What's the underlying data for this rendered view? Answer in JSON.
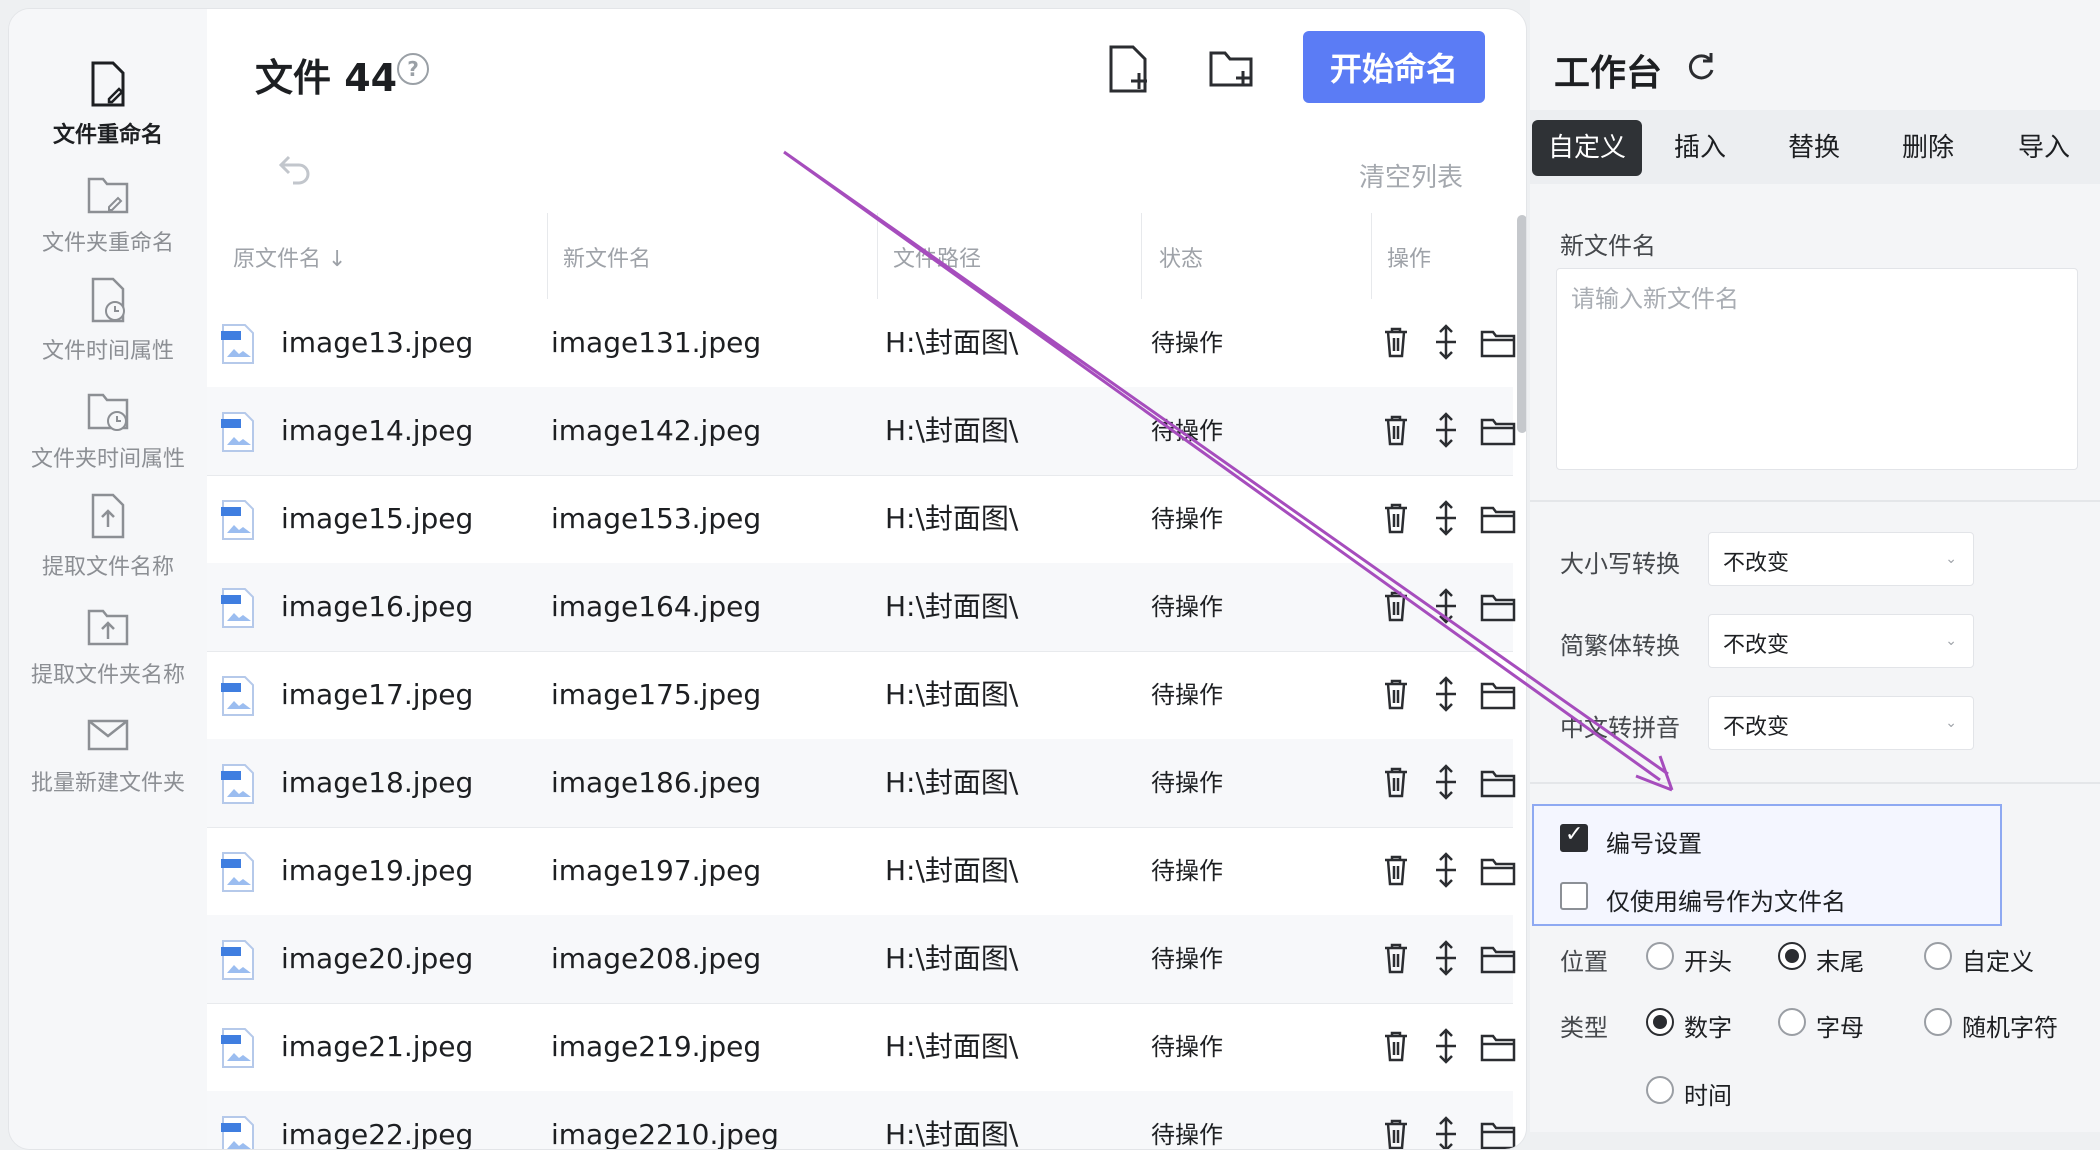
{
  "sidebar": {
    "items": [
      {
        "label": "文件重命名",
        "icon": "file-edit-icon",
        "active": true
      },
      {
        "label": "文件夹重命名",
        "icon": "folder-edit-icon"
      },
      {
        "label": "文件时间属性",
        "icon": "file-clock-icon"
      },
      {
        "label": "文件夹时间属性",
        "icon": "folder-clock-icon"
      },
      {
        "label": "提取文件名称",
        "icon": "file-upload-icon"
      },
      {
        "label": "提取文件夹名称",
        "icon": "folder-upload-icon"
      },
      {
        "label": "批量新建文件夹",
        "icon": "mail-icon"
      }
    ]
  },
  "main": {
    "title": "文件 44",
    "help_icon": "?",
    "start_button": "开始命名",
    "clear_list": "清空列表",
    "columns": [
      "原文件名",
      "新文件名",
      "文件路径",
      "状态",
      "操作"
    ],
    "sort_icon": "↓",
    "rows": [
      {
        "orig": "image13.jpeg",
        "new": "image131.jpeg",
        "path": "H:\\封面图\\",
        "status": "待操作"
      },
      {
        "orig": "image14.jpeg",
        "new": "image142.jpeg",
        "path": "H:\\封面图\\",
        "status": "待操作"
      },
      {
        "orig": "image15.jpeg",
        "new": "image153.jpeg",
        "path": "H:\\封面图\\",
        "status": "待操作"
      },
      {
        "orig": "image16.jpeg",
        "new": "image164.jpeg",
        "path": "H:\\封面图\\",
        "status": "待操作"
      },
      {
        "orig": "image17.jpeg",
        "new": "image175.jpeg",
        "path": "H:\\封面图\\",
        "status": "待操作"
      },
      {
        "orig": "image18.jpeg",
        "new": "image186.jpeg",
        "path": "H:\\封面图\\",
        "status": "待操作"
      },
      {
        "orig": "image19.jpeg",
        "new": "image197.jpeg",
        "path": "H:\\封面图\\",
        "status": "待操作"
      },
      {
        "orig": "image20.jpeg",
        "new": "image208.jpeg",
        "path": "H:\\封面图\\",
        "status": "待操作"
      },
      {
        "orig": "image21.jpeg",
        "new": "image219.jpeg",
        "path": "H:\\封面图\\",
        "status": "待操作"
      },
      {
        "orig": "image22.jpeg",
        "new": "image2210.jpeg",
        "path": "H:\\封面图\\",
        "status": "待操作"
      }
    ]
  },
  "panel": {
    "title": "工作台",
    "tabs": [
      "自定义",
      "插入",
      "替换",
      "删除",
      "导入"
    ],
    "new_name_label": "新文件名",
    "new_name_placeholder": "请输入新文件名",
    "selects": [
      {
        "label": "大小写转换",
        "value": "不改变"
      },
      {
        "label": "简繁体转换",
        "value": "不改变"
      },
      {
        "label": "中文转拼音",
        "value": "不改变"
      }
    ],
    "numbering": {
      "enable_label": "编号设置",
      "enable_checked": true,
      "only_label": "仅使用编号作为文件名",
      "only_checked": false
    },
    "position": {
      "label": "位置",
      "options": [
        "开头",
        "末尾",
        "自定义"
      ],
      "selected": "末尾"
    },
    "type": {
      "label": "类型",
      "options": [
        "数字",
        "字母",
        "随机字符",
        "时间"
      ],
      "selected": "数字"
    }
  },
  "colors": {
    "accent": "#5b7cf5",
    "arrow": "#a64dbd",
    "highlight_border": "#8ea9f2"
  }
}
